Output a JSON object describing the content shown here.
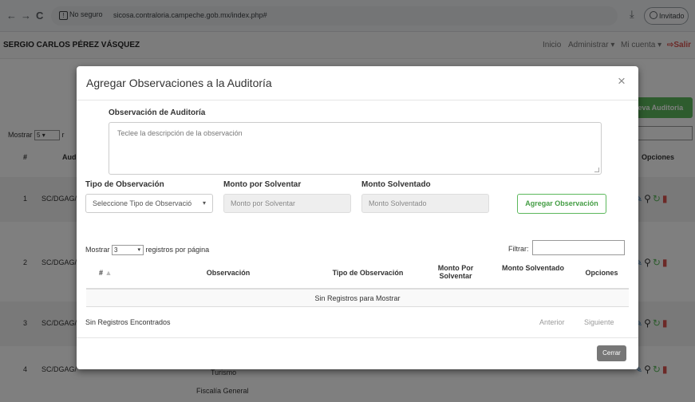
{
  "browser": {
    "back_glyph": "←",
    "forward_glyph": "→",
    "reload_glyph": "C",
    "security_label": "No seguro",
    "url": "sicosa.contraloria.campeche.gob.mx/index.php#",
    "profile_label": "Invitado"
  },
  "header": {
    "user_name": "SERGIO CARLOS PÉREZ VÁSQUEZ",
    "nav": {
      "inicio": "Inicio",
      "administrar": "Administrar ▾",
      "mi_cuenta": "Mi cuenta ▾",
      "salir": "Salir"
    }
  },
  "background_page": {
    "nueva_button": "ueva Auditoria",
    "mostrar_label": "Mostrar",
    "mostrar_value": "5",
    "mostrar_suffix": "r",
    "columns": {
      "num": "#",
      "auditoria": "Aud",
      "opciones": "Opciones"
    },
    "rows": [
      {
        "num": "1",
        "code": "SC/DGAG/"
      },
      {
        "num": "2",
        "code": "SC/DGAG/"
      },
      {
        "num": "3",
        "code": "SC/DGAG/"
      },
      {
        "num": "4",
        "code": "SC/DGAG/"
      }
    ],
    "peek_texts": {
      "turismo": "Turismo",
      "fiscalia": "Fiscalía General"
    }
  },
  "modal": {
    "title": "Agregar Observaciones a la Auditoría",
    "close_glyph": "×",
    "observacion_label": "Observación de Auditoría",
    "observacion_placeholder": "Teclee la descripción de la observación",
    "tipo_label": "Tipo de Observación",
    "tipo_select_value": "Seleccione Tipo de Observació",
    "monto_por_solventar_label": "Monto por Solventar",
    "monto_por_solventar_placeholder": "Monto por Solventar",
    "monto_solventado_label": "Monto Solventado",
    "monto_solventado_placeholder": "Monto Solventado",
    "agregar_button": "Agregar Observación",
    "table": {
      "mostrar_label": "Mostrar",
      "page_size": "3",
      "registros_label": "registros por página",
      "filtrar_label": "Filtrar:",
      "headers": {
        "num": "#",
        "observacion": "Observación",
        "tipo": "Tipo de Observación",
        "monto_por_solventar": "Monto Por Solventar",
        "monto_solventado": "Monto Solventado",
        "opciones": "Opciones"
      },
      "empty_message": "Sin Registros para Mostrar",
      "info": "Sin Registros Encontrados",
      "prev": "Anterior",
      "next": "Siguiente"
    },
    "cerrar_button": "Cerrar"
  },
  "colors": {
    "success": "#5cb85c",
    "danger": "#d9534f",
    "primary": "#337ab7"
  }
}
